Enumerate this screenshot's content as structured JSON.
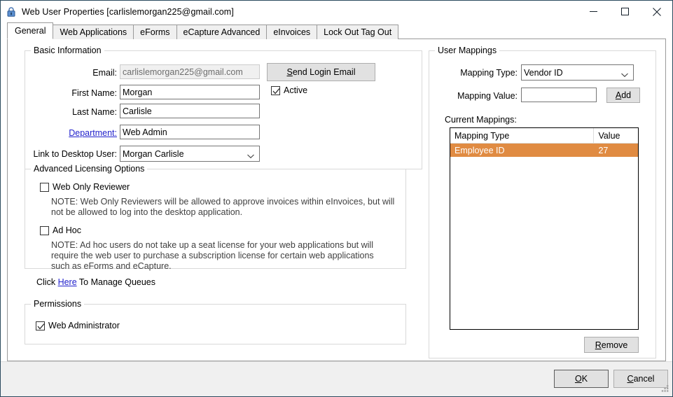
{
  "window": {
    "title": "Web User Properties [carlislemorgan225@gmail.com]",
    "icon": "lock-icon",
    "controls": {
      "minimize": "minimize-icon",
      "maximize": "maximize-icon",
      "close": "close-icon"
    }
  },
  "tabs": [
    {
      "label": "General",
      "selected": true
    },
    {
      "label": "Web Applications",
      "selected": false
    },
    {
      "label": "eForms",
      "selected": false
    },
    {
      "label": "eCapture Advanced",
      "selected": false
    },
    {
      "label": "eInvoices",
      "selected": false
    },
    {
      "label": "Lock Out Tag Out",
      "selected": false
    }
  ],
  "basic_information": {
    "group_title": "Basic Information",
    "email_label": "Email:",
    "email_value": "carlislemorgan225@gmail.com",
    "first_name_label": "First Name:",
    "first_name_value": "Morgan",
    "last_name_label": "Last Name:",
    "last_name_value": "Carlisle",
    "department_label": "Department:",
    "department_value": "Web Admin",
    "link_desktop_label": "Link to Desktop User:",
    "link_desktop_value": "Morgan  Carlisle",
    "send_login_email_button": "Send Login Email",
    "send_login_email_accel": "S",
    "active_label": "Active",
    "active_checked": true
  },
  "advanced_licensing": {
    "group_title": "Advanced Licensing Options",
    "web_only_reviewer_label": "Web Only Reviewer",
    "web_only_reviewer_checked": false,
    "web_only_reviewer_note": "NOTE: Web Only Reviewers will be allowed to approve invoices within eInvoices, but will not be allowed to log into the desktop application.",
    "ad_hoc_label": "Ad Hoc",
    "ad_hoc_checked": false,
    "ad_hoc_note": "NOTE: Ad hoc users do not take up a seat license for your web applications but will require the web user to purchase a subscription license for certain web applications such as eForms and eCapture."
  },
  "manage_queues": {
    "prefix": "Click ",
    "link": "Here",
    "suffix": " To Manage Queues"
  },
  "permissions": {
    "group_title": "Permissions",
    "web_administrator_label": "Web Administrator",
    "web_administrator_checked": true
  },
  "user_mappings": {
    "group_title": "User Mappings",
    "mapping_type_label": "Mapping Type:",
    "mapping_type_value": "Vendor ID",
    "mapping_value_label": "Mapping Value:",
    "mapping_value_value": "",
    "add_button": "Add",
    "add_accel": "A",
    "current_mappings_label": "Current Mappings:",
    "columns": [
      "Mapping Type",
      "Value"
    ],
    "rows": [
      {
        "mapping_type": "Employee ID",
        "value": "27",
        "selected": true
      }
    ],
    "remove_button": "Remove",
    "remove_accel": "R",
    "selection_color": "#e08b42"
  },
  "footer": {
    "ok_button": "OK",
    "ok_accel": "O",
    "cancel_button": "Cancel",
    "cancel_accel": "C"
  }
}
